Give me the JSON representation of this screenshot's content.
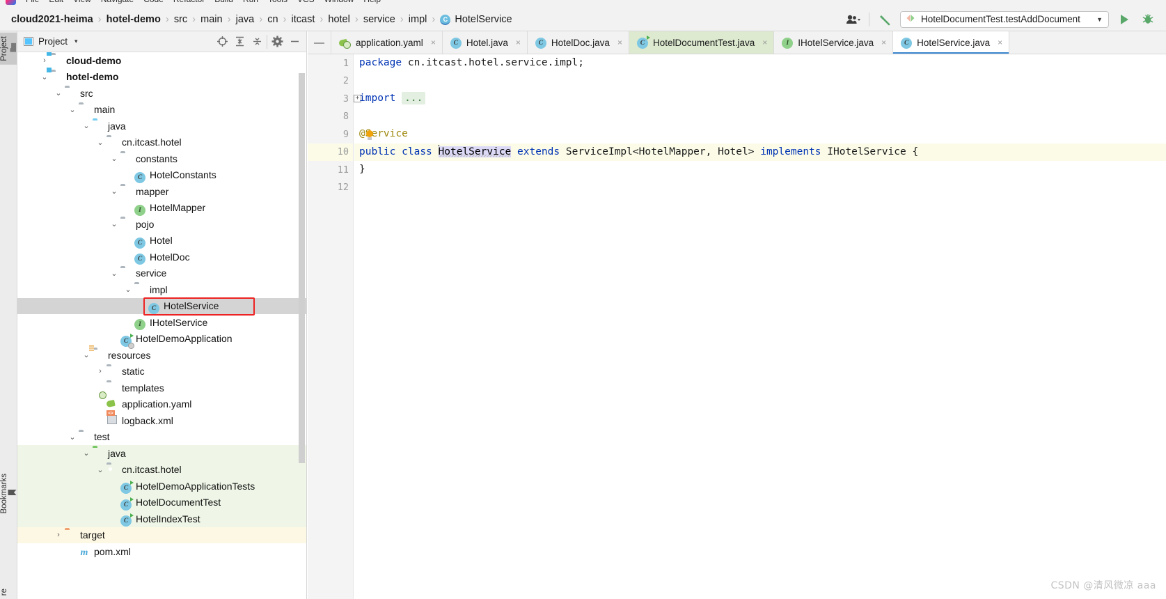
{
  "window": {
    "menu_items": [
      "File",
      "Edit",
      "View",
      "Navigate",
      "Code",
      "Refactor",
      "Build",
      "Run",
      "Tools",
      "VCS",
      "Window",
      "Help"
    ]
  },
  "breadcrumb": {
    "items": [
      {
        "label": "cloud2021-heima",
        "bold": true,
        "icon": ""
      },
      {
        "label": "hotel-demo",
        "bold": true,
        "icon": ""
      },
      {
        "label": "src",
        "bold": false,
        "icon": ""
      },
      {
        "label": "main",
        "bold": false,
        "icon": ""
      },
      {
        "label": "java",
        "bold": false,
        "icon": ""
      },
      {
        "label": "cn",
        "bold": false,
        "icon": ""
      },
      {
        "label": "itcast",
        "bold": false,
        "icon": ""
      },
      {
        "label": "hotel",
        "bold": false,
        "icon": ""
      },
      {
        "label": "service",
        "bold": false,
        "icon": ""
      },
      {
        "label": "impl",
        "bold": false,
        "icon": ""
      },
      {
        "label": "HotelService",
        "bold": false,
        "icon": "class-icon"
      }
    ],
    "separator": "›"
  },
  "toolbar": {
    "account_icon": "user-account-icon",
    "build_icon": "build-hammer-icon",
    "run_config_name": "HotelDocumentTest.testAddDocument",
    "run_config_icon": "run-configuration-icon",
    "run_config_caret": "▼",
    "run_icon": "run-play-icon",
    "debug_icon": "debug-bug-icon"
  },
  "rail": {
    "top_button": {
      "label": "Project",
      "icon": "project-folder-icon"
    },
    "bookmarks_button": {
      "label": "Bookmarks",
      "icon": "bookmark-icon"
    },
    "bottom_button": {
      "label": "re",
      "icon": ""
    }
  },
  "project_panel": {
    "title": "Project",
    "title_caret": "▾",
    "window_icon": "project-window-icon",
    "tools": [
      {
        "name": "locate-icon",
        "glyph": "⊕"
      },
      {
        "name": "expand-all-icon",
        "glyph": "⩞"
      },
      {
        "name": "collapse-all-icon",
        "glyph": "⩟"
      },
      {
        "name": "settings-gear-icon",
        "glyph": "⚙"
      }
    ],
    "tree": [
      {
        "depth": 1,
        "twist": "›",
        "icon": "module-folder",
        "label": "cloud-demo",
        "bold": true,
        "row": ""
      },
      {
        "depth": 1,
        "twist": "⌄",
        "icon": "module-folder",
        "label": "hotel-demo",
        "bold": true,
        "row": ""
      },
      {
        "depth": 2,
        "twist": "⌄",
        "icon": "folder",
        "label": "src",
        "bold": false,
        "row": ""
      },
      {
        "depth": 3,
        "twist": "⌄",
        "icon": "folder",
        "label": "main",
        "bold": false,
        "row": ""
      },
      {
        "depth": 4,
        "twist": "⌄",
        "icon": "source-folder",
        "label": "java",
        "bold": false,
        "row": ""
      },
      {
        "depth": 5,
        "twist": "⌄",
        "icon": "package",
        "label": "cn.itcast.hotel",
        "bold": false,
        "row": ""
      },
      {
        "depth": 6,
        "twist": "⌄",
        "icon": "package",
        "label": "constants",
        "bold": false,
        "row": ""
      },
      {
        "depth": 7,
        "twist": "",
        "icon": "class",
        "label": "HotelConstants",
        "bold": false,
        "row": ""
      },
      {
        "depth": 6,
        "twist": "⌄",
        "icon": "package",
        "label": "mapper",
        "bold": false,
        "row": ""
      },
      {
        "depth": 7,
        "twist": "",
        "icon": "interface",
        "label": "HotelMapper",
        "bold": false,
        "row": ""
      },
      {
        "depth": 6,
        "twist": "⌄",
        "icon": "package",
        "label": "pojo",
        "bold": false,
        "row": ""
      },
      {
        "depth": 7,
        "twist": "",
        "icon": "class",
        "label": "Hotel",
        "bold": false,
        "row": ""
      },
      {
        "depth": 7,
        "twist": "",
        "icon": "class",
        "label": "HotelDoc",
        "bold": false,
        "row": ""
      },
      {
        "depth": 6,
        "twist": "⌄",
        "icon": "package",
        "label": "service",
        "bold": false,
        "row": ""
      },
      {
        "depth": 7,
        "twist": "⌄",
        "icon": "package",
        "label": "impl",
        "bold": false,
        "row": ""
      },
      {
        "depth": 8,
        "twist": "",
        "icon": "class",
        "label": "HotelService",
        "bold": false,
        "row": "selected"
      },
      {
        "depth": 7,
        "twist": "",
        "icon": "interface",
        "label": "IHotelService",
        "bold": false,
        "row": ""
      },
      {
        "depth": 6,
        "twist": "",
        "icon": "spring-class",
        "label": "HotelDemoApplication",
        "bold": false,
        "row": ""
      },
      {
        "depth": 4,
        "twist": "⌄",
        "icon": "resources-folder",
        "label": "resources",
        "bold": false,
        "row": ""
      },
      {
        "depth": 5,
        "twist": "›",
        "icon": "folder",
        "label": "static",
        "bold": false,
        "row": ""
      },
      {
        "depth": 5,
        "twist": "",
        "icon": "folder",
        "label": "templates",
        "bold": false,
        "row": ""
      },
      {
        "depth": 5,
        "twist": "",
        "icon": "yaml",
        "label": "application.yaml",
        "bold": false,
        "row": ""
      },
      {
        "depth": 5,
        "twist": "",
        "icon": "xml",
        "label": "logback.xml",
        "bold": false,
        "row": ""
      },
      {
        "depth": 3,
        "twist": "⌄",
        "icon": "folder",
        "label": "test",
        "bold": false,
        "row": ""
      },
      {
        "depth": 4,
        "twist": "⌄",
        "icon": "test-source-folder",
        "label": "java",
        "bold": false,
        "row": "test"
      },
      {
        "depth": 5,
        "twist": "⌄",
        "icon": "package",
        "label": "cn.itcast.hotel",
        "bold": false,
        "row": "test"
      },
      {
        "depth": 6,
        "twist": "",
        "icon": "test-class",
        "label": "HotelDemoApplicationTests",
        "bold": false,
        "row": "test"
      },
      {
        "depth": 6,
        "twist": "",
        "icon": "test-class",
        "label": "HotelDocumentTest",
        "bold": false,
        "row": "test"
      },
      {
        "depth": 6,
        "twist": "",
        "icon": "test-class",
        "label": "HotelIndexTest",
        "bold": false,
        "row": "test"
      },
      {
        "depth": 2,
        "twist": "›",
        "icon": "target-folder",
        "label": "target",
        "bold": false,
        "row": "target"
      },
      {
        "depth": 3,
        "twist": "",
        "icon": "maven",
        "label": "pom.xml",
        "bold": false,
        "row": ""
      }
    ]
  },
  "editor": {
    "minimize_glyph": "—",
    "tabs": [
      {
        "label": "application.yaml",
        "icon": "yaml-file-icon",
        "state": "",
        "closable": true
      },
      {
        "label": "Hotel.java",
        "icon": "class-file-icon",
        "state": "",
        "closable": true
      },
      {
        "label": "HotelDoc.java",
        "icon": "class-file-icon",
        "state": "",
        "closable": true
      },
      {
        "label": "HotelDocumentTest.java",
        "icon": "test-class-file-icon",
        "state": "green",
        "closable": true
      },
      {
        "label": "IHotelService.java",
        "icon": "interface-file-icon",
        "state": "",
        "closable": true
      },
      {
        "label": "HotelService.java",
        "icon": "class-file-icon",
        "state": "active",
        "closable": true
      }
    ],
    "tab_close_glyph": "×",
    "line_numbers": [
      "1",
      "2",
      "3",
      "8",
      "9",
      "10",
      "11",
      "12"
    ],
    "highlighted_line_index": 5,
    "gutter_run_badge_line_index": 5,
    "fold_marker_line_index": 2,
    "fold_marker_glyph": "⊟",
    "code": [
      {
        "segments": [
          {
            "t": "package",
            "c": "kw"
          },
          {
            "t": " cn.itcast.hotel.service.impl;",
            "c": "plain"
          }
        ]
      },
      {
        "segments": []
      },
      {
        "segments": [
          {
            "t": "import",
            "c": "kw"
          },
          {
            "t": " ",
            "c": "plain"
          },
          {
            "t": "...",
            "c": "fold"
          }
        ]
      },
      {
        "segments": []
      },
      {
        "segments": [
          {
            "t": "@Service",
            "c": "annot"
          }
        ]
      },
      {
        "segments": [
          {
            "t": "public",
            "c": "kw"
          },
          {
            "t": " ",
            "c": "plain"
          },
          {
            "t": "class",
            "c": "kw"
          },
          {
            "t": " ",
            "c": "plain"
          },
          {
            "t": "HotelService",
            "c": "identhl"
          },
          {
            "t": " ",
            "c": "plain"
          },
          {
            "t": "extends",
            "c": "kw"
          },
          {
            "t": " ServiceImpl<HotelMapper, Hotel> ",
            "c": "plain"
          },
          {
            "t": "implements",
            "c": "kw"
          },
          {
            "t": " IHotelService {",
            "c": "plain"
          }
        ]
      },
      {
        "segments": [
          {
            "t": "}",
            "c": "plain"
          }
        ]
      },
      {
        "segments": []
      }
    ]
  },
  "watermark": "CSDN @清风微凉 aaa",
  "colors": {
    "accent_blue": "#3c87d0",
    "keyword_blue": "#0033b3",
    "annotation_gold": "#9e880d",
    "selection_gray": "#d4d4d4",
    "test_green_bg": "#eff6e7",
    "target_yellow_bg": "#fdf8e3",
    "highlight_line": "#fbfbe8",
    "red_annotation": "#ee2222"
  }
}
